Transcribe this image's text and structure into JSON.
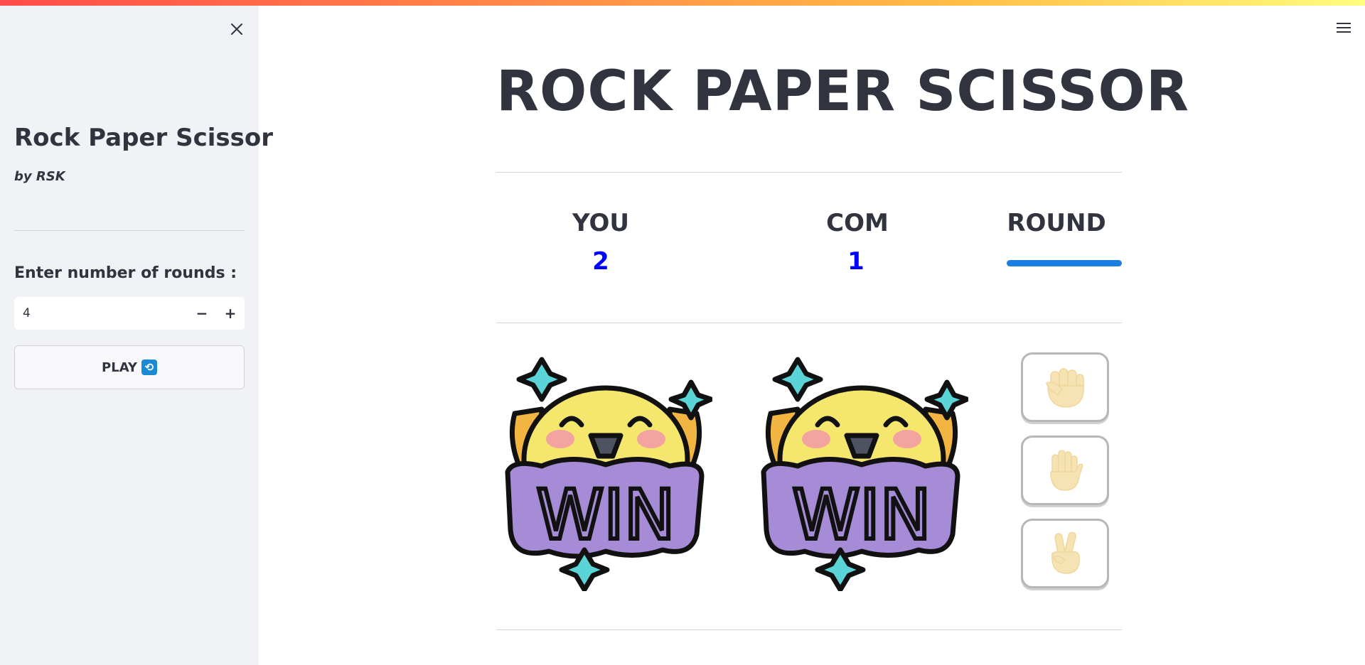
{
  "sidebar": {
    "title": "Rock Paper Scissor",
    "author": "by RSK",
    "rounds_label": "Enter number of rounds :",
    "rounds_value": "4",
    "decrement_label": "−",
    "increment_label": "+",
    "play_label": "PLAY"
  },
  "main": {
    "title": "ROCK PAPER SCISSOR",
    "you_label": "YOU",
    "com_label": "COM",
    "round_label": "ROUND",
    "you_score": "2",
    "com_score": "1",
    "round_progress": 1.0,
    "you_result": "WIN",
    "com_result": "WIN"
  },
  "choices": [
    {
      "name": "rock",
      "icon": "fist-icon"
    },
    {
      "name": "paper",
      "icon": "open-hand-icon"
    },
    {
      "name": "scissors",
      "icon": "victory-hand-icon"
    }
  ],
  "colors": {
    "accent": "#1c7ee0",
    "score": "#0000ff",
    "sidebar_bg": "#f0f2f6",
    "win_banner": "#a68bd6",
    "chick": "#f5e66e",
    "sparkle": "#5ad4d6"
  }
}
